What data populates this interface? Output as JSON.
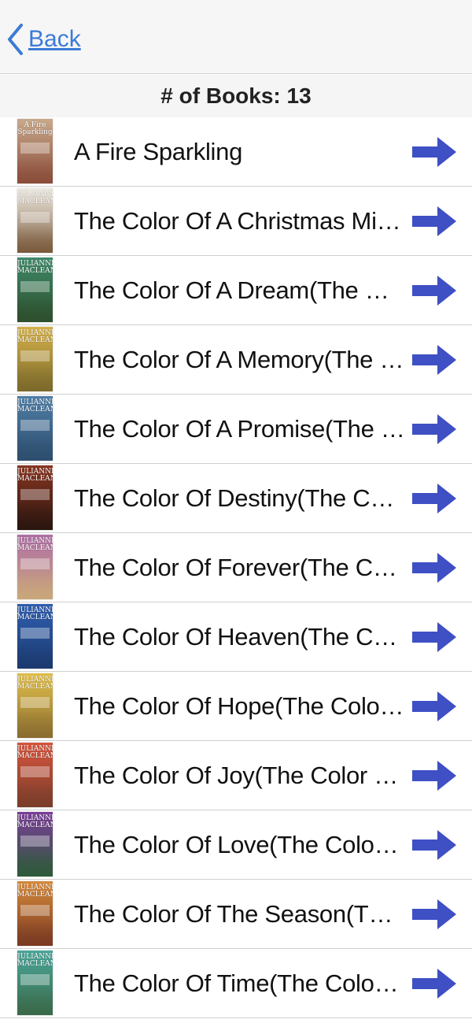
{
  "navbar": {
    "back_label": "Back",
    "back_icon": "chevron-left-icon",
    "accent_color": "#3b7bd6"
  },
  "header": {
    "count_text": "# of Books: 13"
  },
  "arrow_color": "#3f4fc4",
  "books": [
    {
      "title": "A Fire Sparkling",
      "cover_author": "A Fire Sparkling",
      "cover_colors": [
        "#c9a98b",
        "#8a4d3a"
      ]
    },
    {
      "title": "The Color Of A Christmas Miracl...",
      "cover_author": "JULIANNE MACLEAN",
      "cover_colors": [
        "#f1ede4",
        "#7a5a3c"
      ]
    },
    {
      "title": "The Color Of A Dream(The Color...",
      "cover_author": "JULIANNE MACLEAN",
      "cover_colors": [
        "#3f8a6a",
        "#2d4f2c"
      ]
    },
    {
      "title": "The Color Of A Memory(The Col...",
      "cover_author": "JULIANNE MACLEAN",
      "cover_colors": [
        "#d6b24a",
        "#7c6a2b"
      ]
    },
    {
      "title": "The Color Of A Promise(The Col...",
      "cover_author": "JULIANNE MACLEAN",
      "cover_colors": [
        "#4f7fa8",
        "#2e4e6e"
      ]
    },
    {
      "title": "The Color Of Destiny(The Color...",
      "cover_author": "JULIANNE MACLEAN",
      "cover_colors": [
        "#8a3520",
        "#2b1610"
      ]
    },
    {
      "title": "The Color Of Forever(The Color...",
      "cover_author": "JULIANNE MACLEAN",
      "cover_colors": [
        "#b06ea6",
        "#c9a77a"
      ]
    },
    {
      "title": "The Color Of Heaven(The Color...",
      "cover_author": "JULIANNE MACLEAN",
      "cover_colors": [
        "#2f5fb0",
        "#1c3a70"
      ]
    },
    {
      "title": "The Color Of Hope(The Color Of...",
      "cover_author": "JULIANNE MACLEAN",
      "cover_colors": [
        "#e3c04a",
        "#8a6d30"
      ]
    },
    {
      "title": "The Color Of Joy(The Color Of H...",
      "cover_author": "JULIANNE MACLEAN",
      "cover_colors": [
        "#d8553d",
        "#7a3d2a"
      ]
    },
    {
      "title": "The Color Of Love(The Color Of...",
      "cover_author": "JULIANNE MACLEAN",
      "cover_colors": [
        "#7b3e9a",
        "#2e5a3a"
      ]
    },
    {
      "title": "The Color Of The Season(The C...",
      "cover_author": "JULIANNE MACLEAN",
      "cover_colors": [
        "#d88a3a",
        "#7a3a22"
      ]
    },
    {
      "title": "The Color Of Time(The Color Of...",
      "cover_author": "JULIANNE MACLEAN",
      "cover_colors": [
        "#4aa79a",
        "#3a6a4a"
      ]
    }
  ]
}
